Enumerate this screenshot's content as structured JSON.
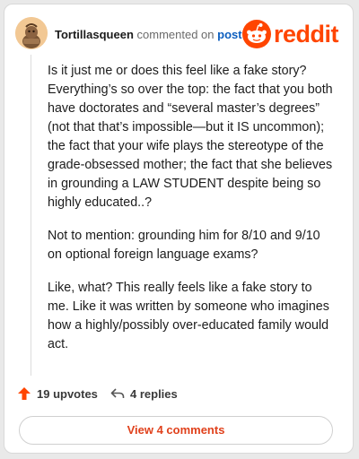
{
  "comment": {
    "username": "Tortillasqueen",
    "action_text": "commented on",
    "post_link": "post",
    "paragraphs": [
      "Is it just me or does this feel like a fake story? Everything’s so over the top: the fact that you both have doctorates and “several master’s degrees” (not that that’s impossible—but it IS uncommon); the fact that your wife plays the stereotype of the grade-obsessed mother; the fact that she believes in grounding a LAW STUDENT despite being so highly educated..?",
      "Not to mention: grounding him for 8/10 and 9/10 on optional foreign language exams?",
      "Like, what? This really feels like a fake story to me. Like it was written by someone who imagines how a highly/possibly over-educated family would act."
    ]
  },
  "brand": {
    "name": "reddit",
    "color": "#ff4500"
  },
  "actions": {
    "upvotes": "19 upvotes",
    "replies": "4 replies",
    "upvote_icon": "upvote-arrow-icon",
    "reply_icon": "reply-arrow-icon"
  },
  "footer": {
    "view_comments": "View 4 comments"
  }
}
